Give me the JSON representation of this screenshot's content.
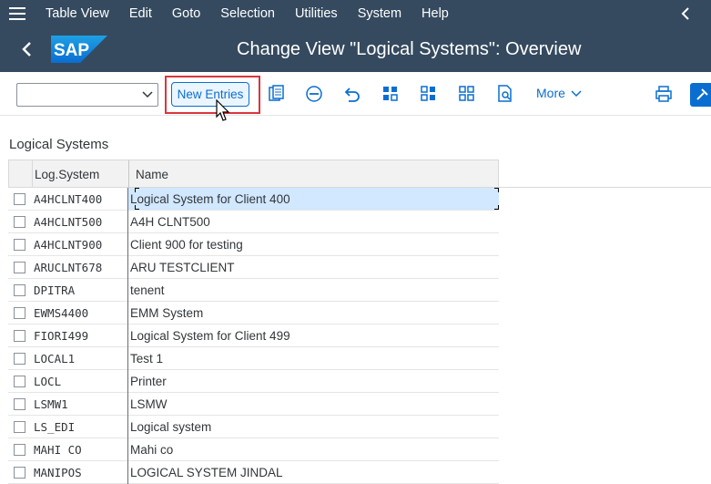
{
  "menu": {
    "items": [
      {
        "label": "Table View"
      },
      {
        "label": "Edit"
      },
      {
        "label": "Goto"
      },
      {
        "label": "Selection"
      },
      {
        "label": "Utilities"
      },
      {
        "label": "System"
      },
      {
        "label": "Help"
      }
    ]
  },
  "shell": {
    "logo_text": "SAP",
    "title": "Change View \"Logical Systems\": Overview"
  },
  "toolbar": {
    "command_field_value": "",
    "new_entries_label": "New Entries",
    "more_label": "More",
    "icons": [
      "copy-icon",
      "delete-icon",
      "undo-icon",
      "select-all-icon",
      "select-block-icon",
      "deselect-all-icon",
      "find-icon",
      "print-icon",
      "settings-icon"
    ]
  },
  "section": {
    "title": "Logical Systems"
  },
  "table": {
    "columns": [
      "Log.System",
      "Name"
    ],
    "rows": [
      {
        "system": "A4HCLNT400",
        "name": "Logical System for Client 400",
        "selected": true
      },
      {
        "system": "A4HCLNT500",
        "name": "A4H CLNT500"
      },
      {
        "system": "A4HCLNT900",
        "name": "Client 900 for testing"
      },
      {
        "system": "ARUCLNT678",
        "name": "ARU TESTCLIENT"
      },
      {
        "system": "DPITRA",
        "name": "tenent"
      },
      {
        "system": "EWMS4400",
        "name": "EMM System"
      },
      {
        "system": "FIORI499",
        "name": "Logical System for Client 499"
      },
      {
        "system": "LOCAL1",
        "name": "Test 1"
      },
      {
        "system": "LOCL",
        "name": "Printer"
      },
      {
        "system": "LSMW1",
        "name": "LSMW"
      },
      {
        "system": "LS_EDI",
        "name": "Logical system"
      },
      {
        "system": "MAHI CO",
        "name": "Mahi co"
      },
      {
        "system": "MANIPOS",
        "name": "LOGICAL SYSTEM JINDAL"
      }
    ]
  },
  "colors": {
    "shell_bg": "#354a5f",
    "accent": "#0a6ed1",
    "highlight_border": "#d9363e",
    "selected_row": "#d1e8ff"
  }
}
